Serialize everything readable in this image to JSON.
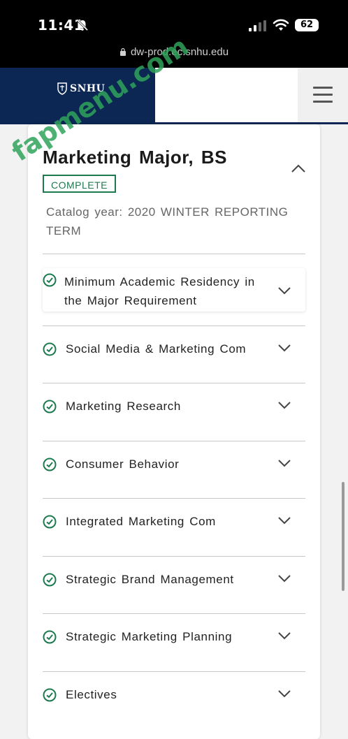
{
  "status_bar": {
    "time": "11:41",
    "battery": "62"
  },
  "browser": {
    "url": "dw-prod.ec.snhu.edu"
  },
  "header": {
    "brand": "SNHU"
  },
  "card": {
    "title": "Marketing Major, BS",
    "badge": "COMPLETE",
    "catalog_line1": "Catalog year:  2020 WINTER REPORTING",
    "catalog_line2": "TERM"
  },
  "requirements": [
    {
      "label_line1": "Minimum Academic Residency in",
      "label_line2": "the Major Requirement",
      "status": "complete"
    },
    {
      "label": "Social Media & Marketing Com",
      "status": "complete"
    },
    {
      "label": "Marketing Research",
      "status": "complete"
    },
    {
      "label": "Consumer Behavior",
      "status": "complete"
    },
    {
      "label": "Integrated Marketing Com",
      "status": "complete"
    },
    {
      "label": "Strategic Brand Management",
      "status": "complete"
    },
    {
      "label": "Strategic Marketing Planning",
      "status": "complete"
    },
    {
      "label": "Electives",
      "status": "complete"
    }
  ],
  "watermark": "fapmenu.com",
  "colors": {
    "brand_navy": "#0c2754",
    "complete_green": "#1d7a4f",
    "watermark_green": "#2fa35a"
  }
}
